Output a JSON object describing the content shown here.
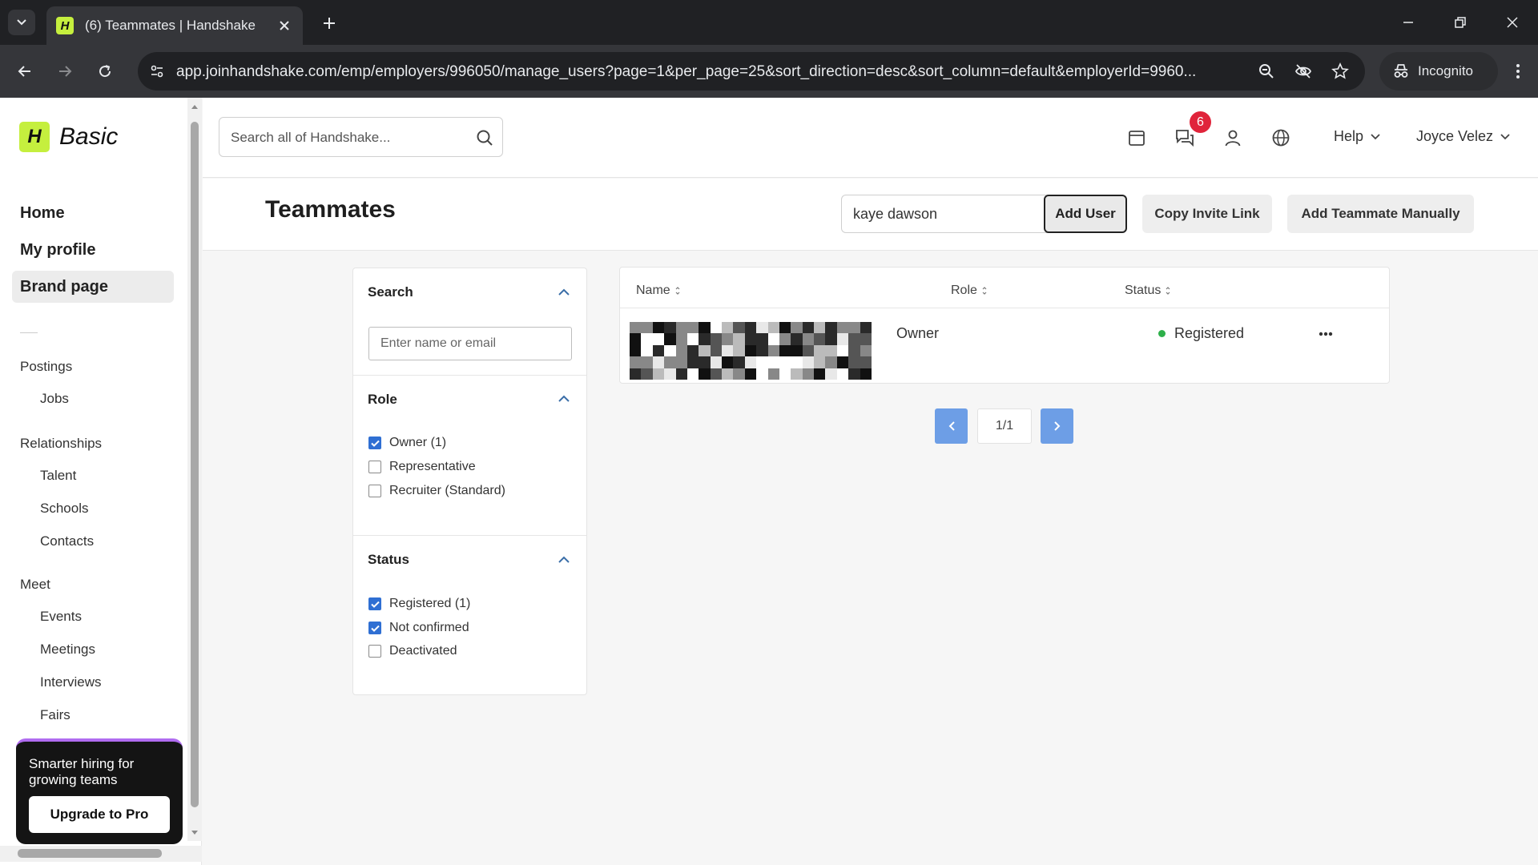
{
  "browser": {
    "tab_title": "(6) Teammates | Handshake",
    "favicon_letter": "H",
    "url": "app.joinhandshake.com/emp/employers/996050/manage_users?page=1&per_page=25&sort_direction=desc&sort_column=default&employerId=9960...",
    "incognito_label": "Incognito"
  },
  "sidebar": {
    "logo_letter": "H",
    "logo_text": "Basic",
    "main_nav": [
      {
        "label": "Home",
        "active": false
      },
      {
        "label": "My profile",
        "active": false
      },
      {
        "label": "Brand page",
        "active": true
      }
    ],
    "sections": [
      {
        "label": "Postings",
        "items": [
          "Jobs"
        ]
      },
      {
        "label": "Relationships",
        "items": [
          "Talent",
          "Schools",
          "Contacts"
        ]
      },
      {
        "label": "Meet",
        "items": [
          "Events",
          "Meetings",
          "Interviews",
          "Fairs"
        ]
      }
    ],
    "promo": {
      "text": "Smarter hiring for growing teams",
      "button": "Upgrade to Pro"
    }
  },
  "header": {
    "search_placeholder": "Search all of Handshake...",
    "notification_count": "6",
    "help_label": "Help",
    "user_name": "Joyce Velez"
  },
  "page": {
    "title": "Teammates",
    "add_user_value": "kaye dawson",
    "add_user_button": "Add User",
    "copy_invite_button": "Copy Invite Link",
    "add_manual_button": "Add Teammate Manually"
  },
  "filters": {
    "search": {
      "heading": "Search",
      "placeholder": "Enter name or email"
    },
    "role": {
      "heading": "Role",
      "options": [
        {
          "label": "Owner (1)",
          "checked": true
        },
        {
          "label": "Representative",
          "checked": false
        },
        {
          "label": "Recruiter (Standard)",
          "checked": false
        }
      ]
    },
    "status": {
      "heading": "Status",
      "options": [
        {
          "label": "Registered (1)",
          "checked": true
        },
        {
          "label": "Not confirmed",
          "checked": true
        },
        {
          "label": "Deactivated",
          "checked": false
        }
      ]
    }
  },
  "table": {
    "columns": [
      "Name",
      "Role",
      "Status"
    ],
    "rows": [
      {
        "name": "",
        "role": "Owner",
        "status": "Registered",
        "status_color": "#2eb04a"
      }
    ]
  },
  "pagination": {
    "page_label": "1/1"
  },
  "colors": {
    "brand_lime": "#c5ef3e",
    "checkbox_blue": "#2f6fd3",
    "pager_blue": "#6d9ee6",
    "badge_red": "#e0243b",
    "promo_accent": "#b06cf0"
  }
}
